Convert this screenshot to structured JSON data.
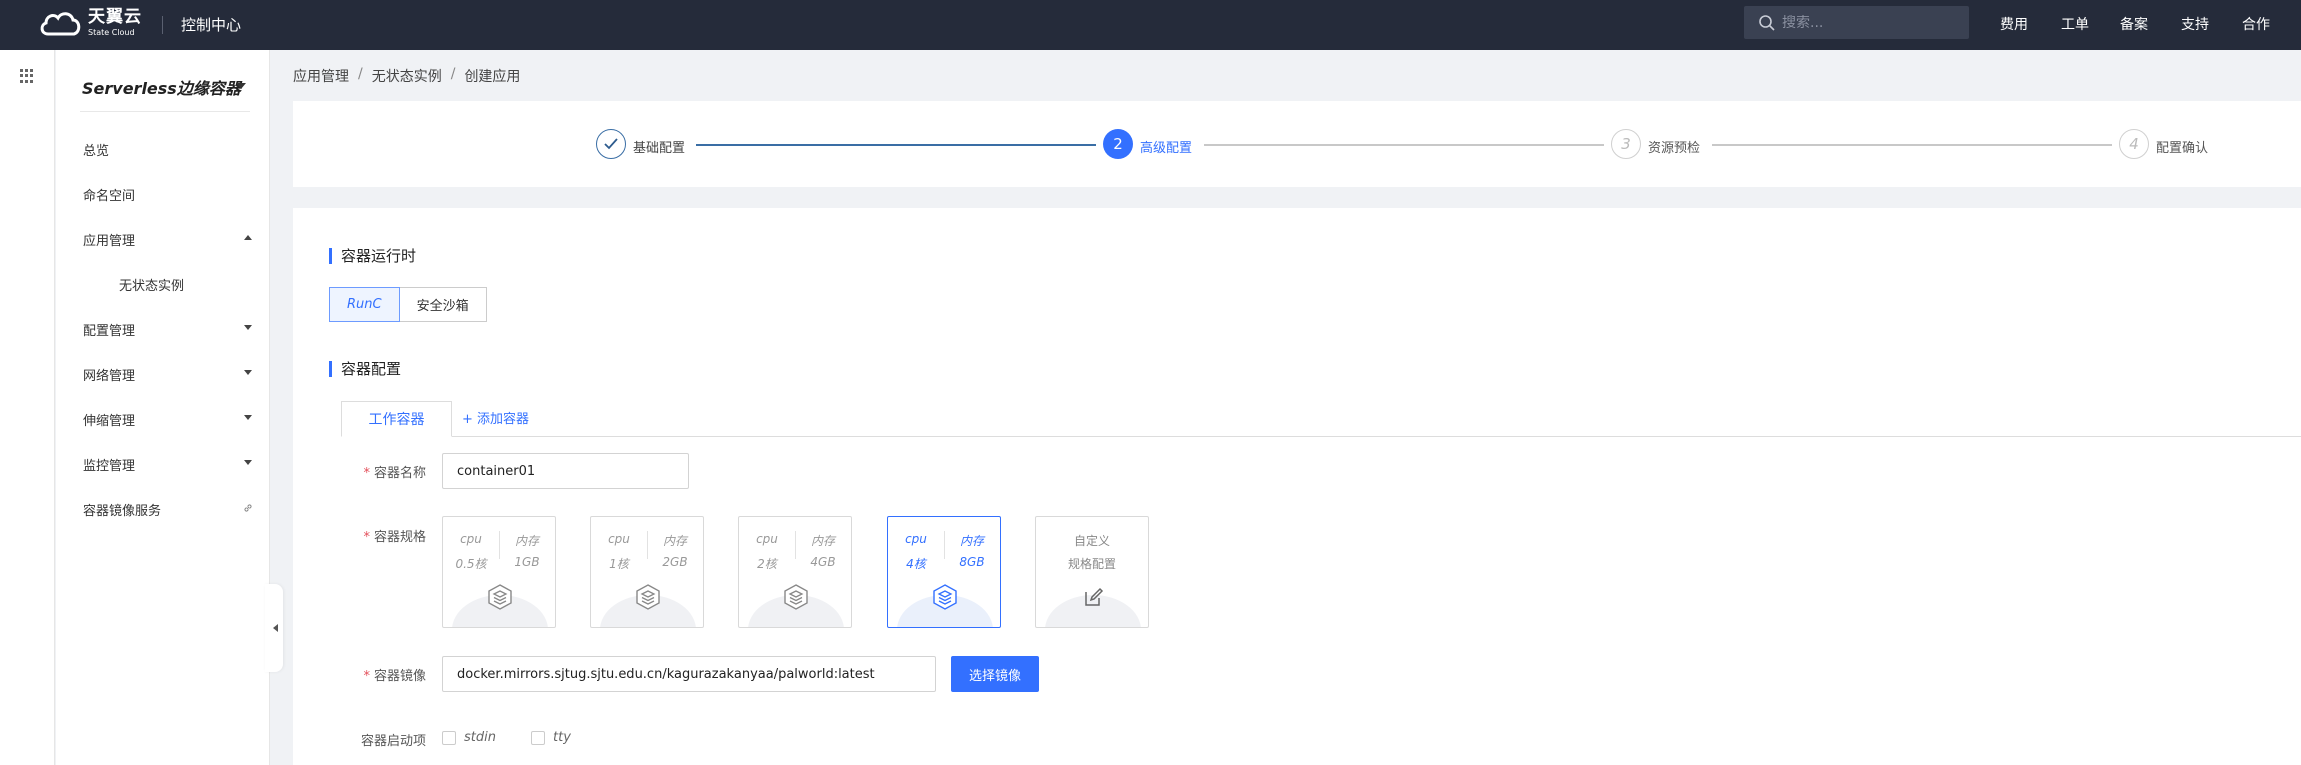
{
  "topbar": {
    "brand_cn": "天翼云",
    "brand_en": "State Cloud",
    "console_title": "控制中心",
    "search_placeholder": "搜索...",
    "links": [
      "费用",
      "工单",
      "备案",
      "支持",
      "合作"
    ]
  },
  "sidebar": {
    "product_title": "Serverless边缘容器",
    "items": [
      {
        "label": "总览"
      },
      {
        "label": "命名空间"
      },
      {
        "label": "应用管理",
        "expanded": true
      },
      {
        "label": "无状态实例",
        "sub": true
      },
      {
        "label": "配置管理"
      },
      {
        "label": "网络管理"
      },
      {
        "label": "伸缩管理"
      },
      {
        "label": "监控管理"
      },
      {
        "label": "容器镜像服务"
      }
    ]
  },
  "breadcrumb": [
    "应用管理",
    "无状态实例",
    "创建应用"
  ],
  "stepper": {
    "steps": [
      {
        "num": "",
        "label": "基础配置",
        "state": "done"
      },
      {
        "num": "2",
        "label": "高级配置",
        "state": "active"
      },
      {
        "num": "3",
        "label": "资源预检",
        "state": "pending"
      },
      {
        "num": "4",
        "label": "配置确认",
        "state": "pending"
      }
    ]
  },
  "form": {
    "runtime_title": "容器运行时",
    "runtime_options": [
      "RunC",
      "安全沙箱"
    ],
    "runtime_selected": "RunC",
    "config_title": "容器配置",
    "tab_work": "工作容器",
    "tab_add": "+ 添加容器",
    "name_label": "容器名称",
    "name_value": "container01",
    "spec_label": "容器规格",
    "specs": [
      {
        "cpu_h": "cpu",
        "mem_h": "内存",
        "cpu": "0.5核",
        "mem": "1GB",
        "selected": false
      },
      {
        "cpu_h": "cpu",
        "mem_h": "内存",
        "cpu": "1核",
        "mem": "2GB",
        "selected": false
      },
      {
        "cpu_h": "cpu",
        "mem_h": "内存",
        "cpu": "2核",
        "mem": "4GB",
        "selected": false
      },
      {
        "cpu_h": "cpu",
        "mem_h": "内存",
        "cpu": "4核",
        "mem": "8GB",
        "selected": true
      }
    ],
    "custom_spec": [
      "自定义",
      "规格配置"
    ],
    "image_label": "容器镜像",
    "image_value": "docker.mirrors.sjtug.sjtu.edu.cn/kagurazakanyaa/palworld:latest",
    "image_button": "选择镜像",
    "startup_label": "容器启动项",
    "startup_options": [
      "stdin",
      "tty"
    ]
  },
  "colors": {
    "primary": "#3370ff",
    "topbar_bg": "#252b3a",
    "required": "#e34d59"
  }
}
